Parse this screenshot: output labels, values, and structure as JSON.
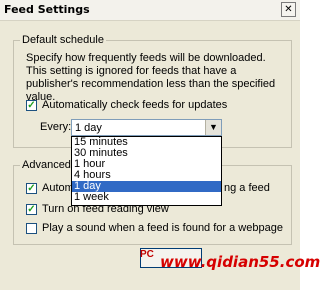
{
  "window": {
    "title": "Feed Settings",
    "close_label": "✕"
  },
  "default_schedule": {
    "legend": "Default schedule",
    "description": "Specify how frequently feeds will be downloaded. This setting is ignored for feeds that have a publisher's recommendation less than the specified value.",
    "auto_check": {
      "label": "Automatically check feeds for updates",
      "checked": true
    },
    "every": {
      "label": "Every:",
      "selected": "1 day",
      "options": [
        "15 minutes",
        "30 minutes",
        "1 hour",
        "4 hours",
        "1 day",
        "1 week"
      ],
      "highlighted_index": 4
    }
  },
  "advanced": {
    "legend": "Advanced",
    "items": [
      {
        "label": "Automa",
        "label_tail": "ng a feed",
        "checked": true
      },
      {
        "label": "Turn on feed reading view",
        "checked": true
      },
      {
        "label": "Play a sound when a feed is found for a webpage",
        "checked": false
      }
    ]
  },
  "watermark": {
    "logo": "PC",
    "text": "www.qidian55.com"
  }
}
